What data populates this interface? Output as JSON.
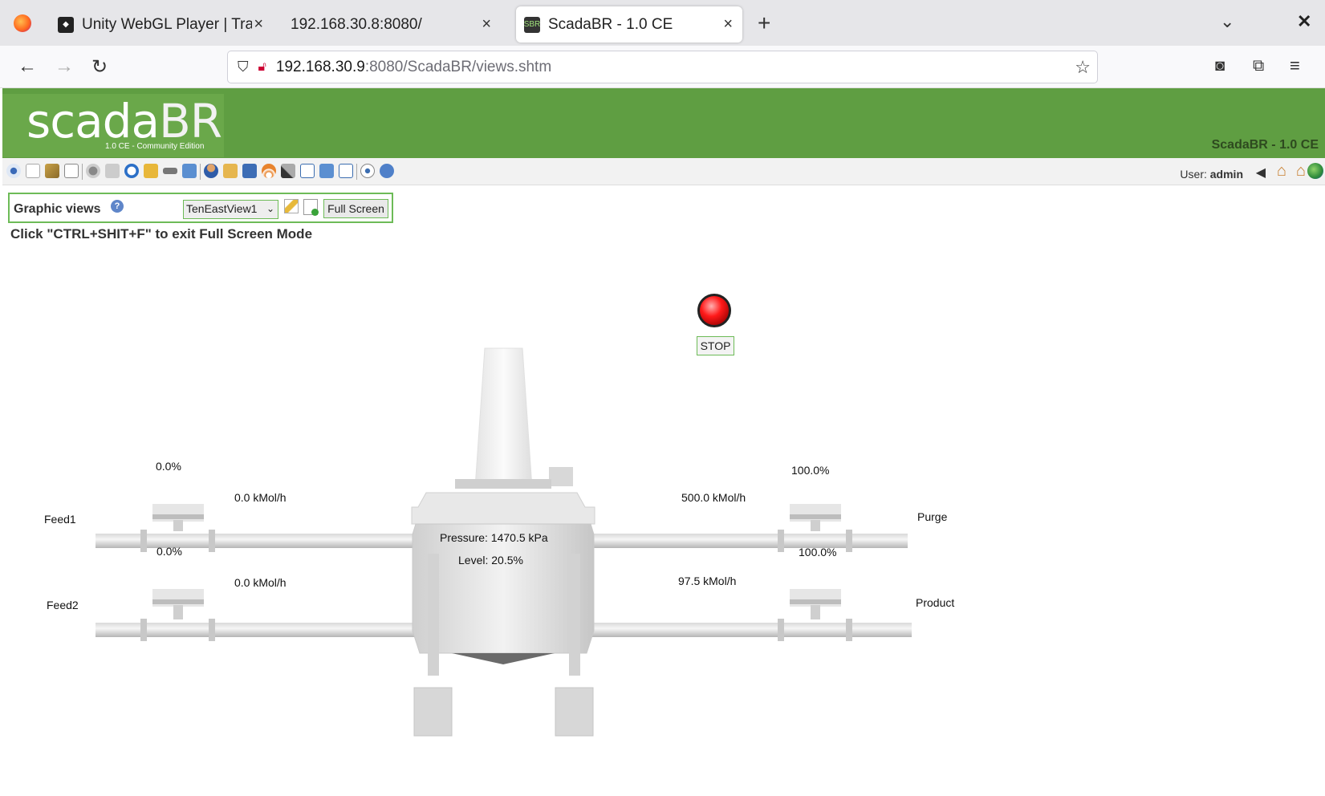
{
  "browser": {
    "tabs": [
      {
        "title": "Unity WebGL Player | Trai",
        "active": false
      },
      {
        "title": "192.168.30.8:8080/",
        "active": false
      },
      {
        "title": "ScadaBR - 1.0 CE",
        "active": true
      }
    ],
    "new_tab": "+",
    "url_host": "192.168.30.9",
    "url_path": ":8080/ScadaBR/views.shtm"
  },
  "header": {
    "logo_main_a": "scada",
    "logo_main_b": "BR",
    "logo_sub": "1.0 CE - Community Edition",
    "app_title": "ScadaBR - 1.0 CE"
  },
  "toolbar": {
    "user_label": "User:",
    "user_name": "admin",
    "icons": [
      "watchlist-icon",
      "graphic-views-icon",
      "events-icon",
      "reports-icon",
      "data-sources-icon",
      "data-point-icon",
      "scheduled-events-icon",
      "compound-events-icon",
      "point-links-icon",
      "scripting-icon",
      "users-icon",
      "point-hierarchy-icon",
      "mailing-lists-icon",
      "publishers-icon",
      "maintenance-events-icon",
      "system-settings-icon",
      "emport-icon",
      "sql-icon",
      "logout-icon",
      "help-icon"
    ]
  },
  "views": {
    "title": "Graphic views",
    "selected_view": "TenEastView1",
    "fullscreen_label": "Full Screen",
    "exit_hint": "Click \"CTRL+SHIT+F\" to exit Full Screen Mode"
  },
  "process": {
    "stop_label": "STOP",
    "status_color": "#ff1a1a",
    "feed1": {
      "label": "Feed1",
      "valve": "0.0%",
      "flow": "0.0 kMol/h"
    },
    "feed2": {
      "label": "Feed2",
      "valve": "0.0%",
      "flow": "0.0 kMol/h"
    },
    "purge": {
      "label": "Purge",
      "valve": "100.0%",
      "flow": "500.0 kMol/h"
    },
    "product": {
      "label": "Product",
      "valve": "100.0%",
      "flow": "97.5 kMol/h"
    },
    "pressure": "Pressure: 1470.5 kPa",
    "level": "Level: 20.5%"
  }
}
